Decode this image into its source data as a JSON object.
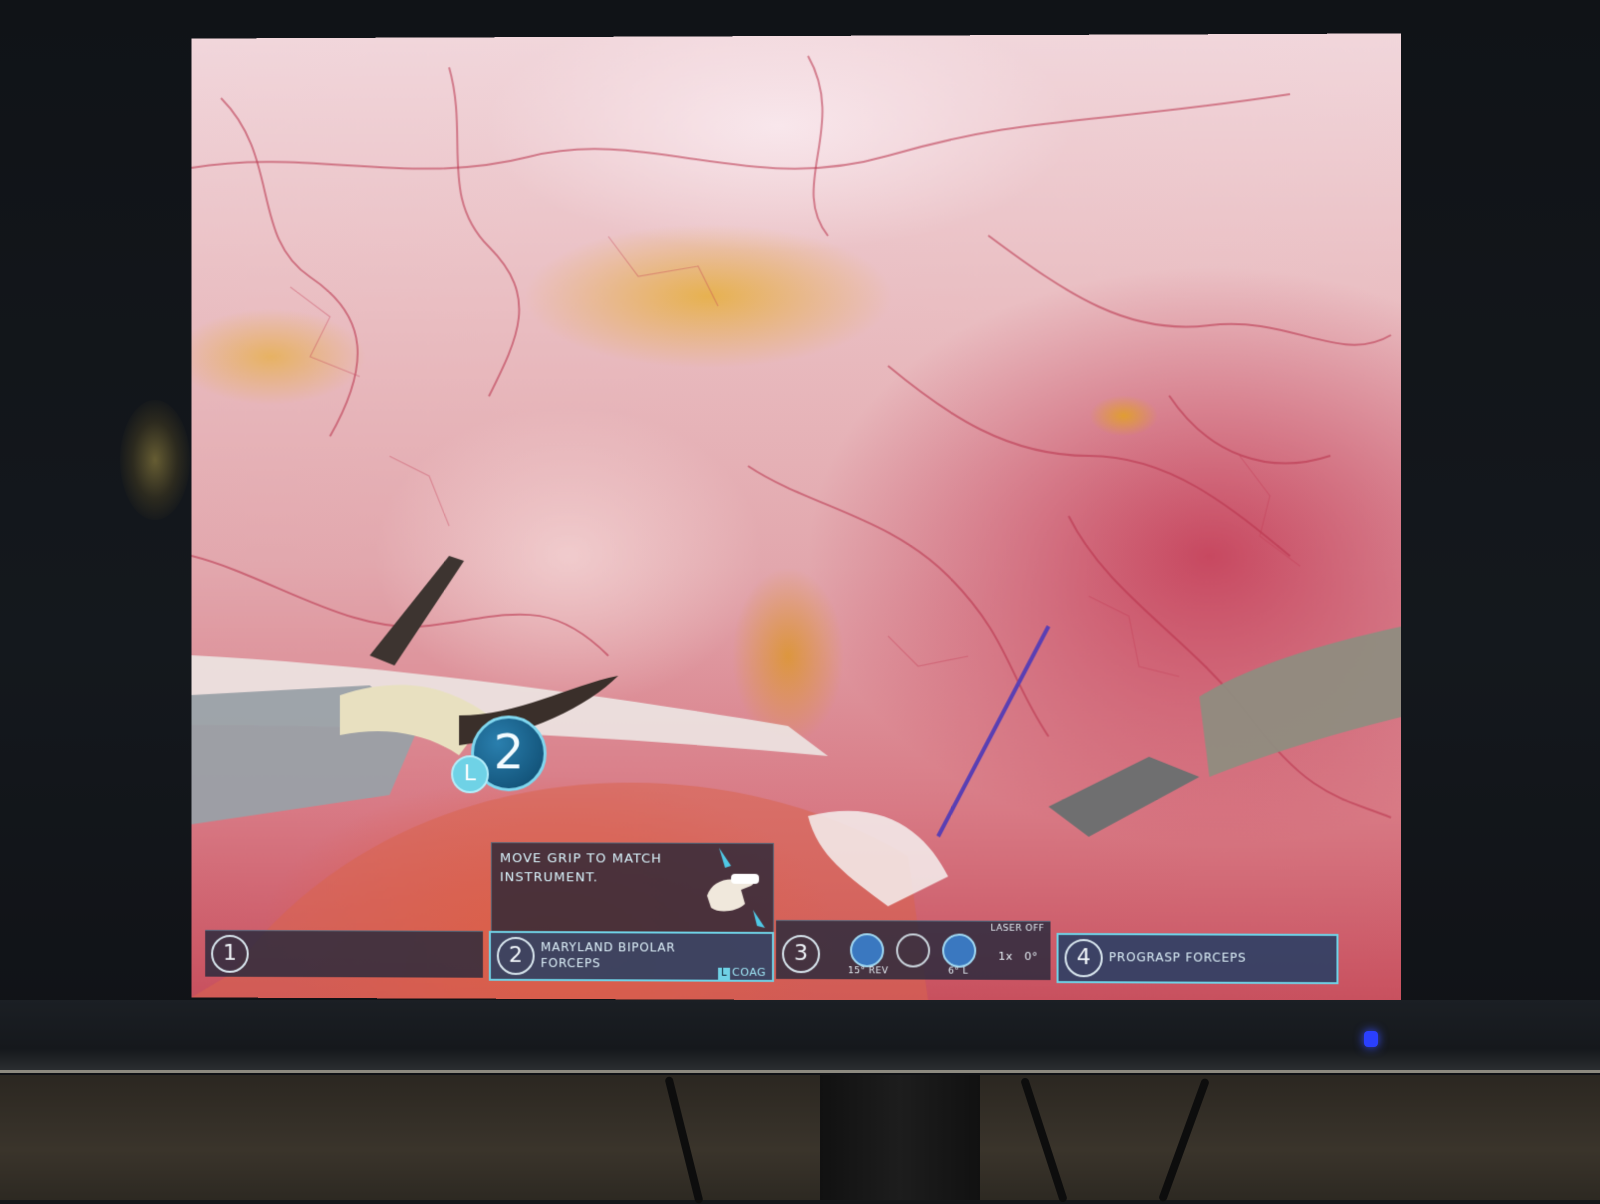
{
  "instrument_tag": {
    "number": "2",
    "side": "L"
  },
  "hint": {
    "text": "MOVE GRIP TO MATCH INSTRUMENT.",
    "icon": "hand-grip-icon"
  },
  "arms": [
    {
      "number": "1",
      "label": "",
      "active": false
    },
    {
      "number": "2",
      "label": "MARYLAND BIPOLAR FORCEPS",
      "energy_side": "L",
      "energy_mode": "COAG",
      "active": true
    },
    {
      "number": "3",
      "label": "",
      "active": false
    },
    {
      "number": "4",
      "label": "PROGRASP FORCEPS",
      "active": true
    }
  ],
  "camera": {
    "laser": "LASER OFF",
    "left_scope": "15° REV",
    "right_scope": "6° L",
    "zoom": "1x",
    "rotation": "0°"
  },
  "colors": {
    "accent": "#6fd2e6",
    "panel": "#1e263a",
    "active_panel": "#183c64"
  }
}
